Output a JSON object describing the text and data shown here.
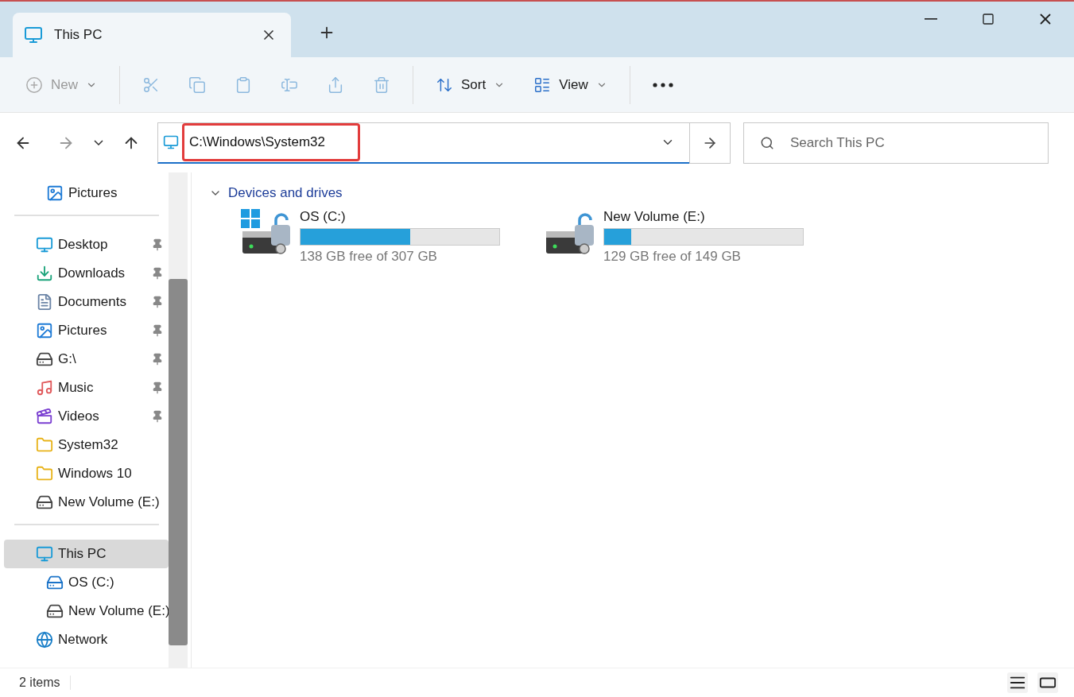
{
  "tab": {
    "title": "This PC"
  },
  "toolbar": [
    {
      "kind": "new",
      "label": "New",
      "disabled": true
    },
    {
      "kind": "cut",
      "disabled": true
    },
    {
      "kind": "copy",
      "disabled": true
    },
    {
      "kind": "paste",
      "disabled": true
    },
    {
      "kind": "rename",
      "disabled": true
    },
    {
      "kind": "share",
      "disabled": true
    },
    {
      "kind": "delete",
      "disabled": true
    },
    {
      "kind": "sort",
      "label": "Sort",
      "disabled": false
    },
    {
      "kind": "view",
      "label": "View",
      "disabled": false
    },
    {
      "kind": "more",
      "disabled": false
    }
  ],
  "address": {
    "value": "C:\\Windows\\System32",
    "highlighted": true
  },
  "search": {
    "placeholder": "Search This PC"
  },
  "sidebar": {
    "sections": [
      {
        "items": [
          {
            "label": "Pictures",
            "kind": "pictures",
            "pinned": false,
            "selected": false
          }
        ]
      },
      {
        "items": [
          {
            "label": "Desktop",
            "kind": "desktop",
            "pinned": true,
            "selected": false
          },
          {
            "label": "Downloads",
            "kind": "downloads",
            "pinned": true,
            "selected": false
          },
          {
            "label": "Documents",
            "kind": "documents",
            "pinned": true,
            "selected": false
          },
          {
            "label": "Pictures",
            "kind": "pictures",
            "pinned": true,
            "selected": false
          },
          {
            "label": "G:\\",
            "kind": "drive",
            "pinned": true,
            "selected": false
          },
          {
            "label": "Music",
            "kind": "music",
            "pinned": true,
            "selected": false
          },
          {
            "label": "Videos",
            "kind": "videos",
            "pinned": true,
            "selected": false
          },
          {
            "label": "System32",
            "kind": "folder",
            "pinned": false,
            "selected": false
          },
          {
            "label": "Windows 10",
            "kind": "folder",
            "pinned": false,
            "selected": false
          },
          {
            "label": "New Volume (E:)",
            "kind": "drive",
            "pinned": false,
            "selected": false
          }
        ]
      },
      {
        "items": [
          {
            "label": "This PC",
            "kind": "pc",
            "pinned": false,
            "selected": true,
            "children": [
              {
                "label": "OS (C:)",
                "kind": "os",
                "pinned": false,
                "selected": false
              },
              {
                "label": "New Volume (E:)",
                "kind": "drive",
                "pinned": false,
                "selected": false
              }
            ]
          },
          {
            "label": "Network",
            "kind": "network",
            "pinned": false,
            "selected": false
          }
        ]
      }
    ]
  },
  "group": {
    "title": "Devices and drives",
    "expanded": true
  },
  "drives": [
    {
      "name": "OS (C:)",
      "kind": "os",
      "level": 0.55,
      "caption": "138 GB free of 307 GB"
    },
    {
      "name": "New Volume (E:)",
      "kind": "drive",
      "level": 0.134,
      "caption": "129 GB free of 149 GB"
    }
  ],
  "status": {
    "count": "2 items"
  }
}
